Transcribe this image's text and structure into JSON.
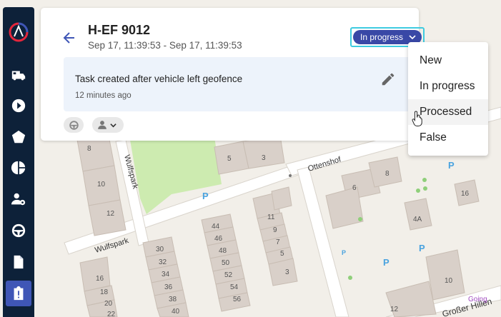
{
  "window": {
    "title": ""
  },
  "sidebar": {
    "items": [
      {
        "icon": "vehicles-icon",
        "active": false
      },
      {
        "icon": "play-icon",
        "active": false
      },
      {
        "icon": "geofence-icon",
        "active": false
      },
      {
        "icon": "pie-chart-icon",
        "active": false
      },
      {
        "icon": "driver-icon",
        "active": false
      },
      {
        "icon": "steering-wheel-icon",
        "active": false
      },
      {
        "icon": "document-icon",
        "active": false
      },
      {
        "icon": "task-clipboard-icon",
        "active": true
      }
    ],
    "accent": "#3f56b6",
    "background": "#0d2139"
  },
  "task": {
    "plate": "H-EF 9012",
    "daterange": "Sep 17, 11:39:53 - Sep 17, 11:39:53",
    "status": "In progress",
    "status_color": "#3948a6",
    "note": {
      "title": "Task created after vehicle left geofence",
      "time": "12 minutes ago"
    }
  },
  "status_menu": {
    "options": [
      "New",
      "In progress",
      "Processed",
      "False"
    ],
    "hovered": "Processed"
  },
  "map": {
    "streets": [
      "Wulfspark",
      "Ottenshof",
      "Wulfspark",
      "Großer Hillen"
    ],
    "poi": [
      "Going"
    ],
    "house_numbers": [
      "8",
      "10",
      "12",
      "5",
      "3",
      "8",
      "6",
      "16",
      "4A",
      "11",
      "9",
      "7",
      "5",
      "3",
      "44",
      "46",
      "48",
      "50",
      "52",
      "54",
      "56",
      "30",
      "32",
      "34",
      "36",
      "38",
      "40",
      "16",
      "18",
      "20",
      "22",
      "12",
      "10"
    ],
    "parking": [
      "P",
      "P",
      "P",
      "P",
      "P"
    ]
  }
}
